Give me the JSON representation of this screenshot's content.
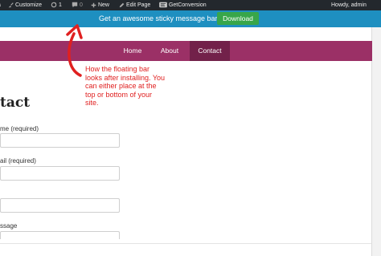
{
  "admin_bar": {
    "customize_label": "Customize",
    "updates_count": "1",
    "comments_count": "0",
    "new_label": "New",
    "edit_page_label": "Edit Page",
    "getconversion_label": "GetConversion",
    "greeting": "Howdy, admin",
    "icons": [
      "brush-icon",
      "updates-icon",
      "comment-icon",
      "plus-icon",
      "pencil-icon",
      "getconversion-logo-icon"
    ]
  },
  "message_bar": {
    "text": "Get an awesome sticky message bar!",
    "button_label": "Download",
    "bar_color": "#1e8fc0",
    "button_color": "#38a64a"
  },
  "nav": {
    "color": "#9b3066",
    "active_color": "#72214a",
    "items": [
      {
        "label": "Home",
        "active": false
      },
      {
        "label": "About",
        "active": false
      },
      {
        "label": "Contact",
        "active": true
      }
    ]
  },
  "annotation": {
    "text": "How the floating bar looks after installing. You can either place at the top or bottom of your site.",
    "color": "#e02020",
    "icon": "curved-arrow-icon"
  },
  "page": {
    "title": "tact",
    "fields": [
      {
        "label": "me (required)"
      },
      {
        "label": "ail (required)"
      },
      {
        "label": ""
      },
      {
        "label": "ssage"
      }
    ]
  }
}
